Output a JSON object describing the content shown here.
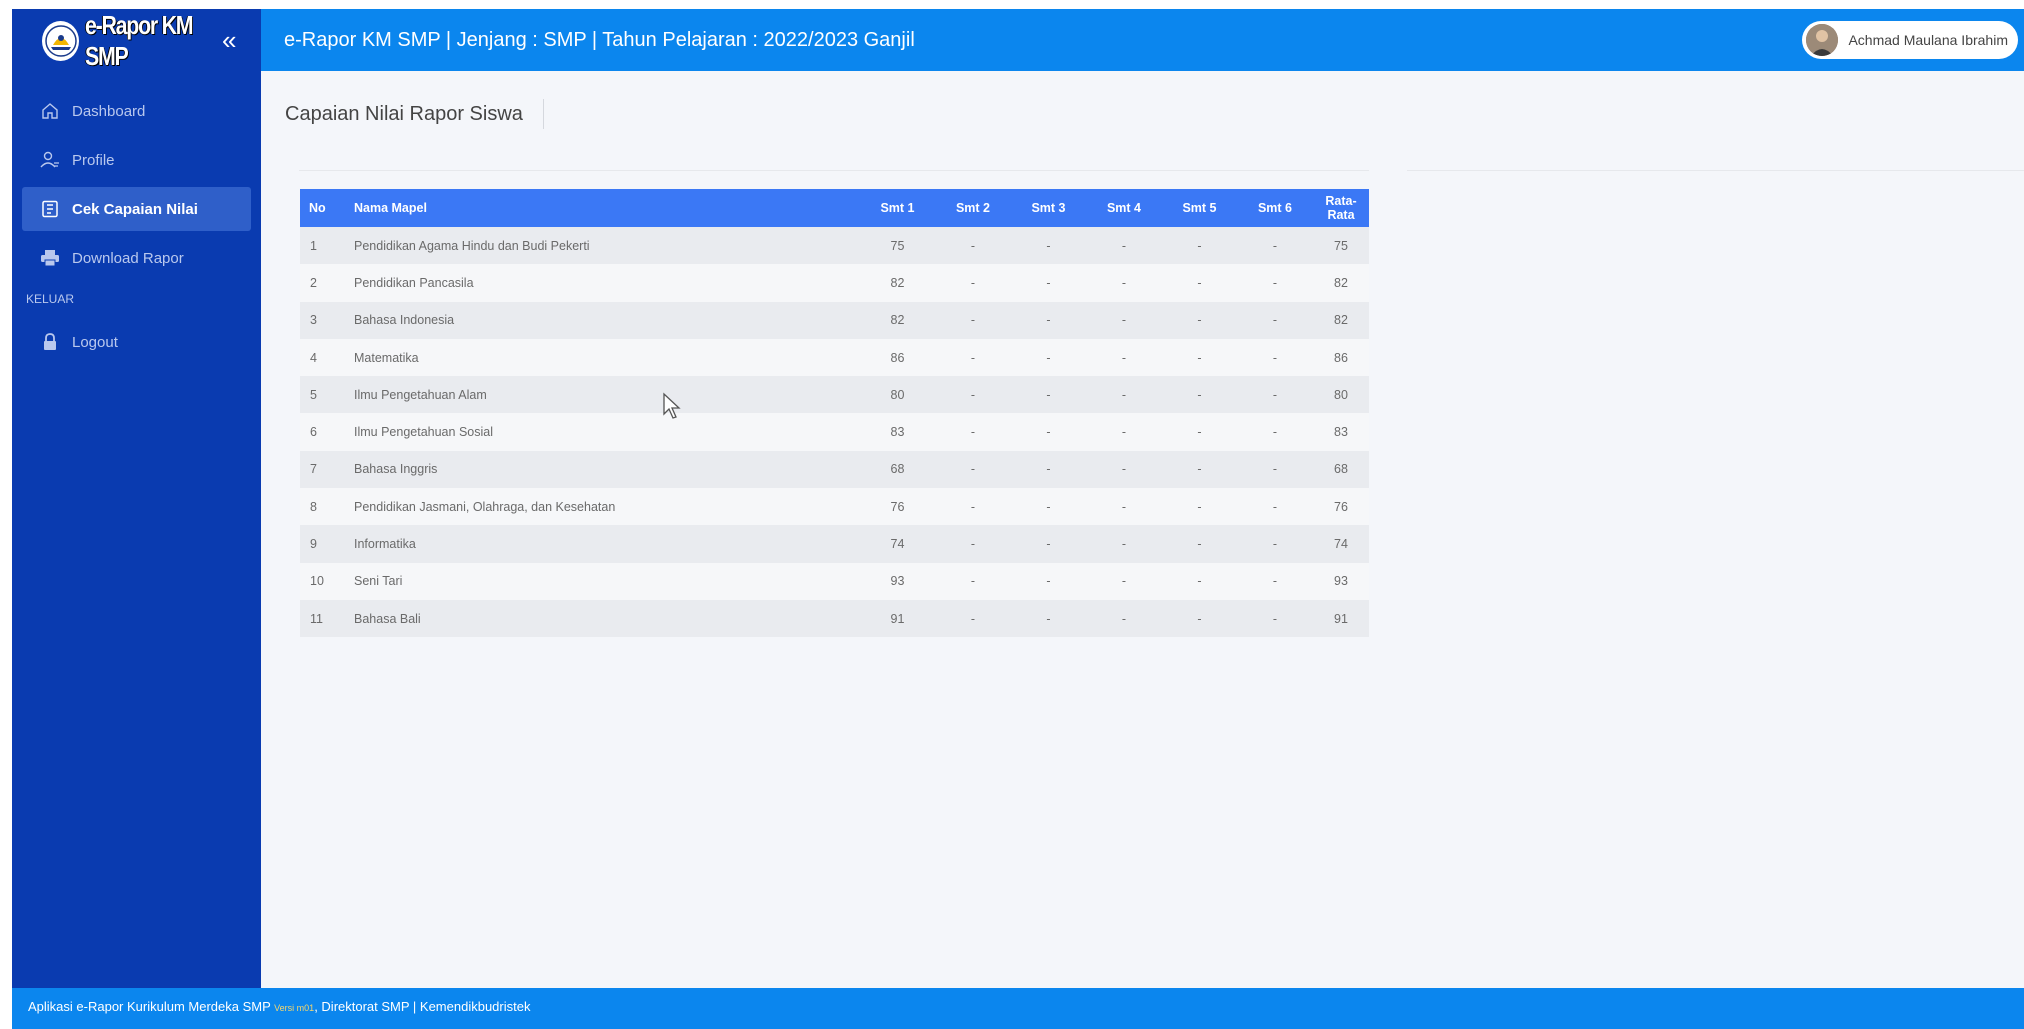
{
  "brand": {
    "name": "e-Rapor KM SMP",
    "collapse_icon": "«"
  },
  "header": {
    "title": "e-Rapor KM SMP | Jenjang : SMP | Tahun Pelajaran : 2022/2023 Ganjil",
    "user_name": "Achmad Maulana Ibrahim"
  },
  "sidebar": {
    "items": [
      {
        "label": "Dashboard",
        "icon": "home-icon"
      },
      {
        "label": "Profile",
        "icon": "user-icon"
      },
      {
        "label": "Cek Capaian Nilai",
        "icon": "report-icon",
        "active": true
      },
      {
        "label": "Download Rapor",
        "icon": "printer-icon"
      }
    ],
    "section_label": "KELUAR",
    "logout_label": "Logout"
  },
  "main": {
    "page_title": "Capaian Nilai Rapor Siswa",
    "table": {
      "columns": [
        "No",
        "Nama Mapel",
        "Smt 1",
        "Smt 2",
        "Smt 3",
        "Smt 4",
        "Smt 5",
        "Smt 6",
        "Rata-Rata"
      ],
      "rows": [
        [
          "1",
          "Pendidikan Agama Hindu dan Budi Pekerti",
          "75",
          "-",
          "-",
          "-",
          "-",
          "-",
          "75"
        ],
        [
          "2",
          "Pendidikan Pancasila",
          "82",
          "-",
          "-",
          "-",
          "-",
          "-",
          "82"
        ],
        [
          "3",
          "Bahasa Indonesia",
          "82",
          "-",
          "-",
          "-",
          "-",
          "-",
          "82"
        ],
        [
          "4",
          "Matematika",
          "86",
          "-",
          "-",
          "-",
          "-",
          "-",
          "86"
        ],
        [
          "5",
          "Ilmu Pengetahuan Alam",
          "80",
          "-",
          "-",
          "-",
          "-",
          "-",
          "80"
        ],
        [
          "6",
          "Ilmu Pengetahuan Sosial",
          "83",
          "-",
          "-",
          "-",
          "-",
          "-",
          "83"
        ],
        [
          "7",
          "Bahasa Inggris",
          "68",
          "-",
          "-",
          "-",
          "-",
          "-",
          "68"
        ],
        [
          "8",
          "Pendidikan Jasmani, Olahraga, dan Kesehatan",
          "76",
          "-",
          "-",
          "-",
          "-",
          "-",
          "76"
        ],
        [
          "9",
          "Informatika",
          "74",
          "-",
          "-",
          "-",
          "-",
          "-",
          "74"
        ],
        [
          "10",
          "Seni Tari",
          "93",
          "-",
          "-",
          "-",
          "-",
          "-",
          "93"
        ],
        [
          "11",
          "Bahasa Bali",
          "91",
          "-",
          "-",
          "-",
          "-",
          "-",
          "91"
        ]
      ]
    }
  },
  "footer": {
    "prefix": "Aplikasi e-Rapor Kurikulum Merdeka SMP",
    "version": "Versi m01",
    "suffix": ", Direktorat SMP | Kemendikbudristek"
  },
  "colors": {
    "sidebar_bg": "#0a3bb0",
    "header_bg": "#0b86ee",
    "table_header_bg": "#3b78f5",
    "active_nav_bg": "#2f5fc9"
  }
}
